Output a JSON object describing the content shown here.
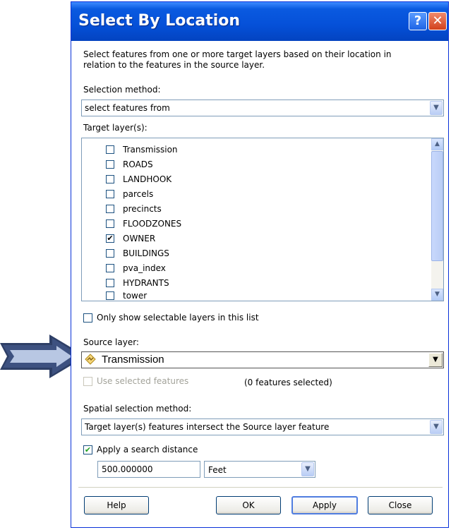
{
  "dialog": {
    "title": "Select By Location",
    "help_glyph": "?",
    "close_glyph": "✕"
  },
  "description": "Select features from one or more target layers based on their location in relation to the features in the source layer.",
  "selection_method": {
    "label": "Selection method:",
    "value": "select features from"
  },
  "target_layers": {
    "label": "Target layer(s):",
    "items": [
      {
        "name": "Transmission",
        "checked": false
      },
      {
        "name": "ROADS",
        "checked": false
      },
      {
        "name": "LANDHOOK",
        "checked": false
      },
      {
        "name": "parcels",
        "checked": false
      },
      {
        "name": "precincts",
        "checked": false
      },
      {
        "name": "FLOODZONES",
        "checked": false
      },
      {
        "name": "OWNER",
        "checked": true
      },
      {
        "name": "BUILDINGS",
        "checked": false
      },
      {
        "name": "pva_index",
        "checked": false
      },
      {
        "name": "HYDRANTS",
        "checked": false
      },
      {
        "name": "tower",
        "checked": false
      }
    ],
    "only_selectable_label": "Only show selectable layers in this list",
    "only_selectable_checked": false
  },
  "source_layer": {
    "label": "Source layer:",
    "value": "Transmission",
    "icon": "line-layer-icon",
    "use_selected_label": "Use selected features",
    "features_selected": "(0 features selected)"
  },
  "spatial_method": {
    "label": "Spatial selection method:",
    "value": "Target layer(s) features intersect the Source layer feature"
  },
  "search_distance": {
    "label": "Apply a search distance",
    "checked": true,
    "value": "500.000000",
    "unit": "Feet"
  },
  "buttons": {
    "help": "Help",
    "ok": "OK",
    "apply": "Apply",
    "close": "Close"
  },
  "colors": {
    "titlebar": "#0550d8",
    "arrow": "#2e3f66",
    "dialog_bg": "#ffffff"
  }
}
